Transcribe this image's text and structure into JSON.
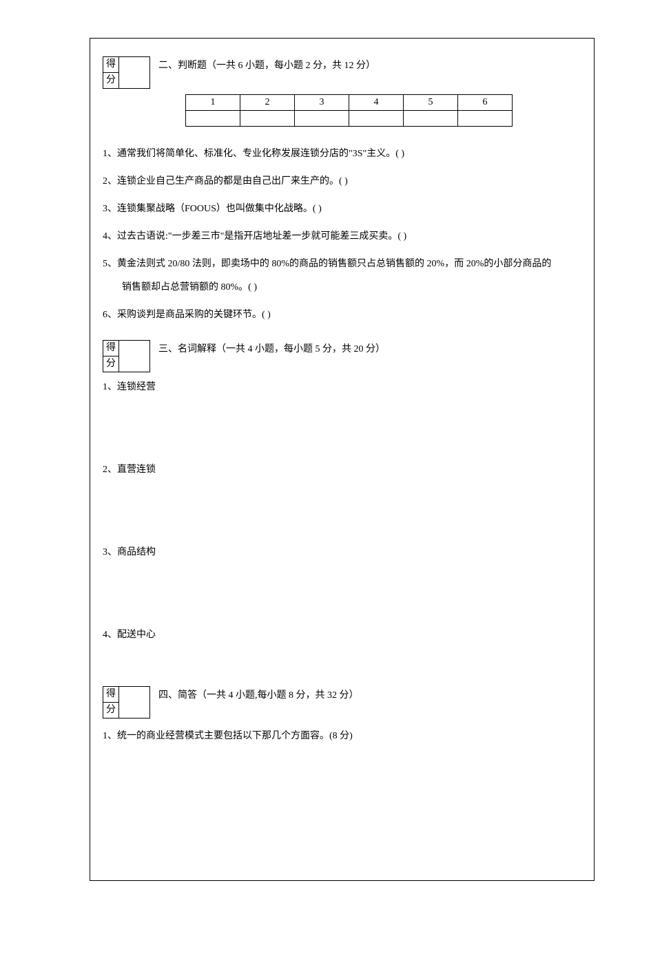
{
  "score_label": {
    "c1": "得",
    "c2": "分"
  },
  "sections": {
    "s2": {
      "title": "二、判断题（一共 6 小题，每小题 2 分，共 12 分）"
    },
    "s3": {
      "title": "三、名词解释（一共 4 小题，每小题 5 分，共 20 分）"
    },
    "s4": {
      "title": "四、简答（一共 4 小题,每小题 8 分，共 32 分）"
    }
  },
  "answer_numbers": [
    "1",
    "2",
    "3",
    "4",
    "5",
    "6"
  ],
  "judgment": {
    "q1": "1、通常我们将简单化、标准化、专业化称发展连锁分店的\"3S\"主义。(      )",
    "q2": "2、连锁企业自己生产商品的都是由自己出厂来生产的。(      )",
    "q3": "3、连锁集聚战略（FOOUS）也叫做集中化战略。(      )",
    "q4": "4、过去古语说:\"一步差三市\"是指开店地址差一步就可能差三成买卖。(      )",
    "q5a": "5、黄金法则式 20/80 法则，即卖场中的 80%的商品的销售额只占总销售额的 20%，而 20%的小部分商品的",
    "q5b": "销售额却占总营销额的 80%。(      )",
    "q6": "6、采购谈判是商品采购的关键环节。(      )"
  },
  "terms": {
    "q1": "1、连锁经营",
    "q2": "2、直营连锁",
    "q3": "3、商品结构",
    "q4": "4、配送中心"
  },
  "short_answer": {
    "q1": "1、统一的商业经营模式主要包括以下那几个方面容。(8 分)"
  }
}
